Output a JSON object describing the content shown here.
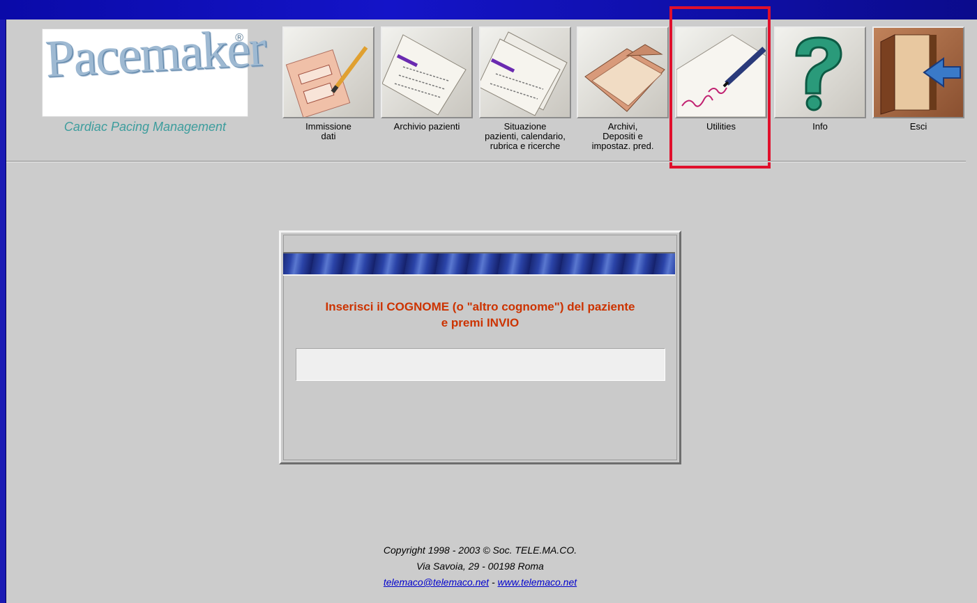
{
  "logo": {
    "word": "Pacemaker",
    "registered": "®",
    "tagline": "Cardiac Pacing Management"
  },
  "toolbar": [
    {
      "id": "immissione",
      "label": "Immissione\ndati",
      "icon": "form-pen-icon"
    },
    {
      "id": "archivio",
      "label": "Archivio pazienti",
      "icon": "document-icon"
    },
    {
      "id": "situazione",
      "label": "Situazione\npazienti, calendario,\nrubrica e ricerche",
      "icon": "documents-stack-icon"
    },
    {
      "id": "archivi",
      "label": "Archivi,\nDepositi e\nimpostaz. pred.",
      "icon": "folder-icon"
    },
    {
      "id": "utilities",
      "label": "Utilities",
      "icon": "signature-pen-icon",
      "highlighted": true
    },
    {
      "id": "info",
      "label": "Info",
      "icon": "question-mark-icon"
    },
    {
      "id": "esci",
      "label": "Esci",
      "icon": "exit-door-icon"
    }
  ],
  "dialog": {
    "prompt": "Inserisci il COGNOME (o \"altro cognome\") del paziente\ne premi INVIO",
    "input_value": ""
  },
  "footer": {
    "copyright": "Copyright 1998 - 2003 © Soc. TELE.MA.CO.",
    "address": "Via Savoia, 29 - 00198 Roma",
    "email": "telemaco@telemaco.net",
    "separator": " - ",
    "website": "www.telemaco.net"
  },
  "colors": {
    "highlight": "#e0102c",
    "prompt": "#cc3300",
    "tagline": "#3d9d9d",
    "titlebar": "#1414c8"
  }
}
